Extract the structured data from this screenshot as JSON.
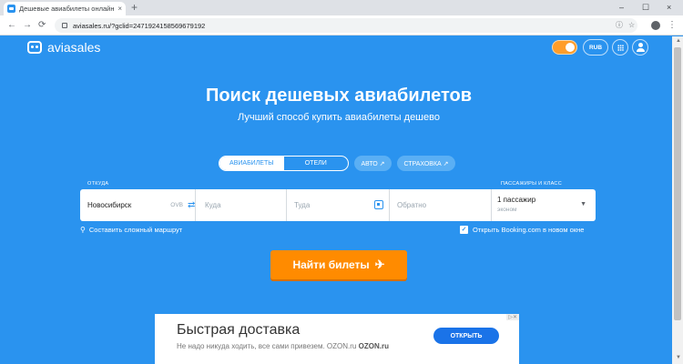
{
  "browser": {
    "tab_title": "Дешевые авиабилеты онлайн, ц",
    "tab_close": "×",
    "new_tab": "+",
    "minimize": "–",
    "maximize": "☐",
    "close": "×",
    "back": "←",
    "forward": "→",
    "reload": "⟳",
    "url": "aviasales.ru/?gclid=247192415856967​9192",
    "icons": [
      "back-icon",
      "forward-icon",
      "reload-icon",
      "lock-icon",
      "info-icon",
      "star-icon",
      "account-icon",
      "menu-icon"
    ]
  },
  "header": {
    "logo_text": "aviasales",
    "currency": "RUB"
  },
  "hero": {
    "title": "Поиск дешевых авиабилетов",
    "subtitle": "Лучший способ купить авиабилеты дешево"
  },
  "tabs": {
    "tickets": "АВИАБИЛЕТЫ",
    "hotels": "ОТЕЛИ",
    "auto": "АВТО ↗",
    "insurance": "СТРАХОВКА ↗"
  },
  "search": {
    "from_label": "ОТКУДА",
    "from_value": "Новосибирск",
    "from_iata": "OVB",
    "to_placeholder": "Куда",
    "depart_placeholder": "Туда",
    "return_placeholder": "Обратно",
    "pass_label": "ПАССАЖИРЫ И КЛАСС",
    "passengers": "1 пассажир",
    "cabin": "эконом",
    "complex_route": "Составить сложный маршрут",
    "booking_checkbox": "Открыть Booking.com в новом окне",
    "submit": "Найти билеты"
  },
  "ad": {
    "title": "Быстрая доставка",
    "text": "Не надо никуда ходить, все сами привезем. OZON.ru",
    "brand": "OZON.ru",
    "button": "ОТКРЫТЬ",
    "corner": "▷✕"
  },
  "colors": {
    "background": "#2a93ef",
    "cta": "#ff8b00",
    "ad_button": "#1a73e8"
  }
}
